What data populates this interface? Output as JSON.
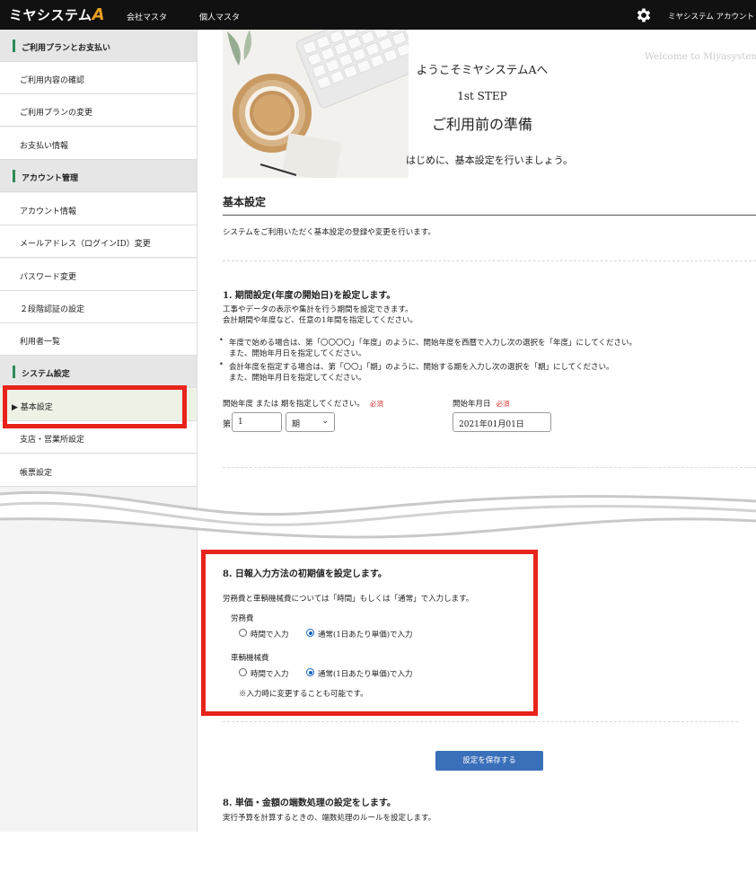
{
  "header": {
    "logo_text": "ミヤシステム",
    "logo_letter": "A",
    "nav": [
      "会社マスタ",
      "個人マスタ"
    ],
    "account_label": "ミヤシステム アカウント"
  },
  "sidebar": {
    "items": [
      {
        "label": "ご利用プランとお支払い",
        "type": "header"
      },
      {
        "label": "ご利用内容の確認",
        "type": "item"
      },
      {
        "label": "ご利用プランの変更",
        "type": "item"
      },
      {
        "label": "お支払い情報",
        "type": "item"
      },
      {
        "label": "アカウント管理",
        "type": "header"
      },
      {
        "label": "アカウント情報",
        "type": "item"
      },
      {
        "label": "メールアドレス（ログインID）変更",
        "type": "item"
      },
      {
        "label": "パスワード変更",
        "type": "item"
      },
      {
        "label": "２段階認証の設定",
        "type": "item"
      },
      {
        "label": "利用者一覧",
        "type": "item"
      },
      {
        "label": "システム設定",
        "type": "header"
      },
      {
        "label": "▶ 基本設定",
        "type": "active"
      },
      {
        "label": "支店・営業所設定",
        "type": "item"
      },
      {
        "label": "帳票設定",
        "type": "item"
      }
    ]
  },
  "hero": {
    "welcome_en": "Welcome to Miyasystem.",
    "welcome_jp": "ようこそミヤシステムAへ",
    "step": "1st STEP",
    "title": "ご利用前の準備",
    "subtitle": "はじめに、基本設定を行いましょう。"
  },
  "basic": {
    "title": "基本設定",
    "desc": "システムをご利用いただく基本設定の登録や変更を行います。"
  },
  "period": {
    "title": "1. 期間設定(年度の開始日)を設定します。",
    "desc1": "工事やデータの表示や集計を行う期間を設定できます。",
    "desc2": "会計期間や年度など、任意の1年間を指定してください。",
    "bullet1a": "年度で始める場合は、第「〇〇〇〇」「年度」のように、開始年度を西暦で入力し次の選択を「年度」にしてください。",
    "bullet1b": "また、開始年月日を指定してください。",
    "bullet2a": "会計年度を指定する場合は、第「〇〇」「期」のように、開始する期を入力し次の選択を「期」にしてください。",
    "bullet2b": "また、開始年月日を指定してください。",
    "start_label": "開始年度 または 期を指定してください。",
    "required": "必須",
    "prefix": "第",
    "number_value": "1",
    "unit_selected": "期",
    "date_label": "開始年月日",
    "date_value": "2021年01月01日"
  },
  "daily": {
    "title": "8. 日報入力方法の初期値を設定します。",
    "desc": "労務費と車輌機械費については「時間」もしくは「通常」で入力します。",
    "labor_label": "労務費",
    "vehicle_label": "車輌機械費",
    "opt_time": "時間で入力",
    "opt_normal": "通常(1日あたり単価)で入力",
    "labor_selected": "normal",
    "vehicle_selected": "normal",
    "note": "※入力時に変更することも可能です。"
  },
  "save_label": "設定を保存する",
  "rounding": {
    "title": "8. 単価・金額の端数処理の設定をします。",
    "desc": "実行予算を計算するときの、端数処理のルールを設定します。"
  },
  "colors": {
    "highlight": "#e8231b",
    "primary": "#3a6fb9",
    "accent_bar": "#2e8b57"
  }
}
